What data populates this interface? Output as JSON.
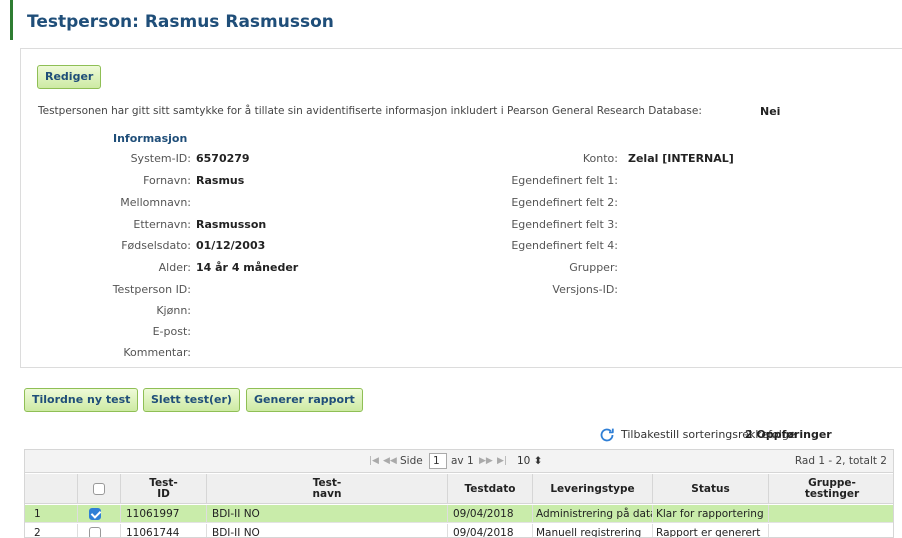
{
  "header": {
    "title": "Testperson: Rasmus Rasmusson"
  },
  "edit_button": "Rediger",
  "consent": {
    "text": "Testpersonen har gitt sitt samtykke for å tillate sin avidentifiserte informasjon inkludert i Pearson General Research Database:",
    "value": "Nei"
  },
  "info": {
    "heading": "Informasjon",
    "left": [
      {
        "label": "System-ID:",
        "value": "6570279"
      },
      {
        "label": "Fornavn:",
        "value": "Rasmus"
      },
      {
        "label": "Mellomnavn:",
        "value": ""
      },
      {
        "label": "Etternavn:",
        "value": "Rasmusson"
      },
      {
        "label": "Fødselsdato:",
        "value": "01/12/2003"
      },
      {
        "label": "Alder:",
        "value": "14 år 4 måneder"
      },
      {
        "label": "Testperson ID:",
        "value": ""
      },
      {
        "label": "Kjønn:",
        "value": ""
      },
      {
        "label": "E-post:",
        "value": ""
      },
      {
        "label": "Kommentar:",
        "value": ""
      }
    ],
    "right": [
      {
        "label": "Konto:",
        "value": "Zelal [INTERNAL]"
      },
      {
        "label": "Egendefinert felt 1:",
        "value": ""
      },
      {
        "label": "Egendefinert felt 2:",
        "value": ""
      },
      {
        "label": "Egendefinert felt 3:",
        "value": ""
      },
      {
        "label": "Egendefinert felt 4:",
        "value": ""
      },
      {
        "label": "Grupper:",
        "value": ""
      },
      {
        "label": "Versjons-ID:",
        "value": ""
      }
    ]
  },
  "toolbar": {
    "assign_label": "Tilordne ny test",
    "delete_label": "Slett test(er)",
    "report_label": "Generer rapport"
  },
  "reset": {
    "label": "Tilbakestill sorteringsrekkefølge",
    "entries": "2 Oppføringer",
    "icon": "refresh-icon"
  },
  "pager": {
    "first": "|◀",
    "prev": "◀◀",
    "page_label": "Side",
    "page_value": "1",
    "of_label": "av 1",
    "next": "▶▶",
    "last": "▶|",
    "rows_value": "10",
    "rows_arrow": "⬍",
    "summary": "Rad 1 - 2, totalt 2"
  },
  "table": {
    "columns": {
      "id_1": "Test-",
      "id_2": "ID",
      "name_1": "Test-",
      "name_2": "navn",
      "date": "Testdato",
      "delivery": "Leveringstype",
      "status": "Status",
      "group_1": "Gruppe-",
      "group_2": "testinger"
    },
    "rows": [
      {
        "n": "1",
        "checked": true,
        "id": "11061997",
        "name": "BDI-II NO",
        "date": "09/04/2018",
        "delivery": "Administrering på data",
        "status": "Klar for rapportering",
        "group": ""
      },
      {
        "n": "2",
        "checked": false,
        "id": "11061744",
        "name": "BDI-II NO",
        "date": "09/04/2018",
        "delivery": "Manuell registrering",
        "status": "Rapport er generert",
        "group": ""
      }
    ]
  },
  "colors": {
    "title": "#1f4e79",
    "accent": "#2e7d32",
    "button_bg": "#cdeaa3",
    "selected_row": "#c9ecaa",
    "checkbox": "#2f7fd6"
  }
}
